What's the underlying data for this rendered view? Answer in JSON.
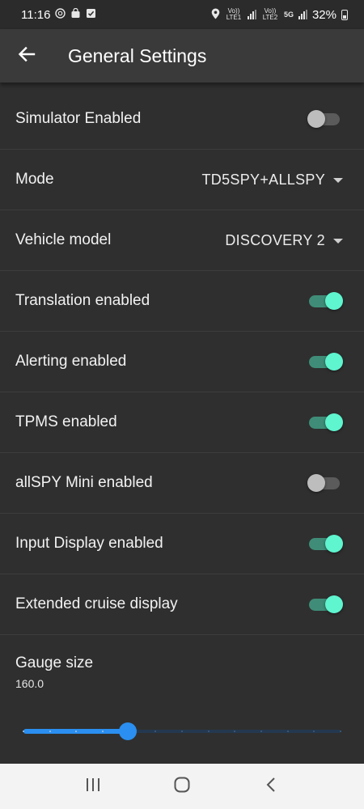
{
  "status_bar": {
    "time": "11:16",
    "left_icons": [
      "wallet-icon",
      "bag-icon",
      "check-icon"
    ],
    "right_icons": [
      "location-icon",
      "volte-lte1-icon",
      "signal-icon",
      "volte-lte2-icon",
      "5g-icon",
      "signal-icon"
    ],
    "lte1": "Vo)) LTE1",
    "lte2": "Vo)) LTE2",
    "net": "5G",
    "battery": "32%"
  },
  "header": {
    "title": "General Settings",
    "back_icon": "arrow-back-icon"
  },
  "settings": [
    {
      "label": "Simulator Enabled",
      "type": "switch",
      "on": false
    },
    {
      "label": "Mode",
      "type": "dropdown",
      "value": "TD5SPY+ALLSPY"
    },
    {
      "label": "Vehicle model",
      "type": "dropdown",
      "value": "DISCOVERY 2"
    },
    {
      "label": "Translation enabled",
      "type": "switch",
      "on": true
    },
    {
      "label": "Alerting enabled",
      "type": "switch",
      "on": true
    },
    {
      "label": "TPMS enabled",
      "type": "switch",
      "on": true
    },
    {
      "label": "allSPY Mini enabled",
      "type": "switch",
      "on": false
    },
    {
      "label": "Input Display enabled",
      "type": "switch",
      "on": true
    },
    {
      "label": "Extended cruise display",
      "type": "switch",
      "on": true
    }
  ],
  "gauge": {
    "label": "Gauge size",
    "value": "160.0",
    "slider_fraction": 0.33,
    "tick_count": 13
  },
  "nav_bar": {
    "icons": [
      "recent-apps-icon",
      "home-icon",
      "back-icon"
    ]
  },
  "colors": {
    "background": "#2f2f2f",
    "app_bar": "#3a3a3a",
    "switch_on_thumb": "#5ef5cf",
    "switch_on_track": "#3f8d78",
    "switch_off_thumb": "#bdbdbd",
    "slider_accent": "#2a8ff0"
  }
}
